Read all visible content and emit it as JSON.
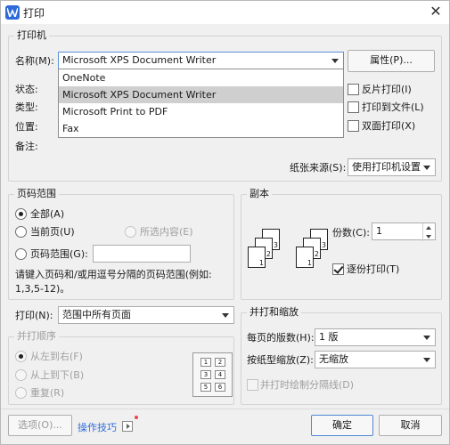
{
  "window": {
    "title": "打印",
    "close_glyph": "✕"
  },
  "printer": {
    "legend": "打印机",
    "name_label": "名称(M):",
    "selected": "Microsoft XPS Document Writer",
    "properties_button": "属性(P)...",
    "status_label": "状态:",
    "type_label": "类型:",
    "location_label": "位置:",
    "comment_label": "备注:",
    "options": [
      "OneNote",
      "Microsoft XPS Document Writer",
      "Microsoft Print to PDF",
      "Fax"
    ],
    "reverse_print": "反片打印(I)",
    "print_to_file": "打印到文件(L)",
    "duplex": "双面打印(X)",
    "paper_source_label": "纸张来源(S):",
    "paper_source_value": "使用打印机设置"
  },
  "page_range": {
    "legend": "页码范围",
    "all": "全部(A)",
    "current": "当前页(U)",
    "selection": "所选内容(E)",
    "range": "页码范围(G):",
    "range_value": "",
    "hint": "请键入页码和/或用逗号分隔的页码范围(例如:",
    "hint2": "1,3,5-12)。"
  },
  "copies": {
    "legend": "副本",
    "count_label": "份数(C):",
    "count_value": "1",
    "collate": "逐份打印(T)"
  },
  "print_what": {
    "label": "打印(N):",
    "value": "范围中所有页面"
  },
  "order": {
    "legend": "并打顺序",
    "left_to_right": "从左到右(F)",
    "top_to_bottom": "从上到下(B)",
    "repeat": "重复(R)",
    "grid": [
      "1",
      "2",
      "3",
      "4",
      "5",
      "6"
    ]
  },
  "zoom": {
    "legend": "并打和缩放",
    "pages_per_sheet_label": "每页的版数(H):",
    "pages_per_sheet_value": "1 版",
    "scale_label": "按纸型缩放(Z):",
    "scale_value": "无缩放",
    "draw_borders": "并打时绘制分隔线(D)"
  },
  "footer": {
    "options_button": "选项(O)...",
    "tips_link": "操作技巧",
    "ok_button": "确定",
    "cancel_button": "取消"
  }
}
